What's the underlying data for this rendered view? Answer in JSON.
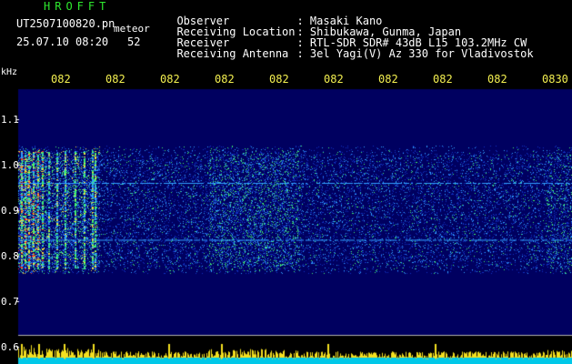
{
  "header": {
    "app_title": "HROFFT",
    "file_name": "UT2507100820.pn",
    "mode_label": "meteor",
    "date_time": "25.07.10 08:20",
    "count": "52",
    "info": [
      {
        "key": "Observer",
        "value": "Masaki Kano"
      },
      {
        "key": "Receiving Location",
        "value": "Shibukawa, Gunma, Japan"
      },
      {
        "key": "Receiver",
        "value": "RTL-SDR SDR# 43dB L15 103.2MHz CW"
      },
      {
        "key": "Receiving Antenna",
        "value": "3el Yagi(V) Az 330 for Vladivostok"
      }
    ],
    "separator": ":"
  },
  "chart_data": {
    "type": "heatmap",
    "xlabel": "",
    "ylabel": "kHz",
    "x_tick_labels": [
      "082",
      "082",
      "082",
      "082",
      "082",
      "082",
      "082",
      "082",
      "082",
      "0830"
    ],
    "y_tick_labels": [
      "1.1",
      "1.0",
      "0.9",
      "0.8",
      "0.7",
      "0.6"
    ],
    "y_ticks": [
      1.1,
      1.0,
      0.9,
      0.8,
      0.7,
      0.6
    ],
    "ylim": [
      0.6,
      1.12
    ],
    "horizontal_lines_khz": [
      0.96,
      0.835
    ],
    "active_bands_khz": [
      0.76,
      1.04
    ],
    "colors": {
      "background": "#000060",
      "weak": "#1030c0",
      "medium": "#30a0ff",
      "strong": "#40f070",
      "peak": "#f0e040",
      "max": "#ff3020",
      "grid": "#b0b0b0",
      "level_bars": "#f4e020",
      "level_base": "#00c8e8"
    }
  }
}
